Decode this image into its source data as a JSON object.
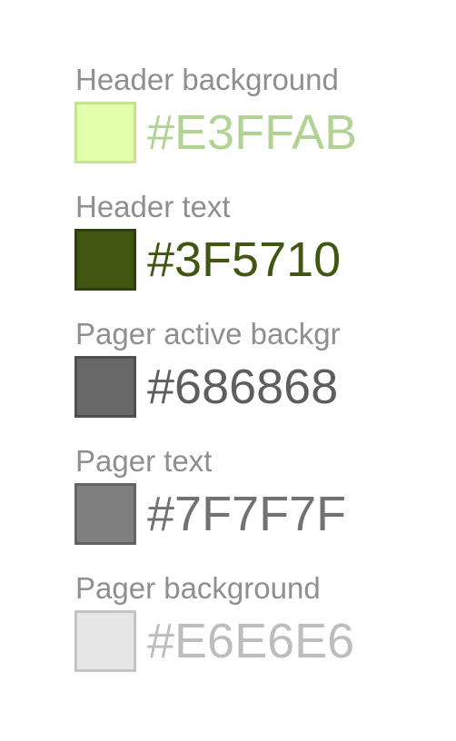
{
  "swatches": [
    {
      "label": "Header background",
      "hex": "#E3FFAB",
      "fill": "#E3FFAB",
      "border": "#C6E294",
      "text_color": "#B2D393"
    },
    {
      "label": "Header text",
      "hex": "#3F5710",
      "fill": "#3F5710",
      "border": "#2D3F0C",
      "text_color": "#3F5710"
    },
    {
      "label": "Pager active backgr",
      "hex": "#686868",
      "fill": "#686868",
      "border": "#505050",
      "text_color": "#5E5E5E"
    },
    {
      "label": "Pager text",
      "hex": "#7F7F7F",
      "fill": "#7F7F7F",
      "border": "#636363",
      "text_color": "#727272"
    },
    {
      "label": "Pager background",
      "hex": "#E6E6E6",
      "fill": "#E6E6E6",
      "border": "#C4C4C4",
      "text_color": "#BDBDBD"
    }
  ]
}
